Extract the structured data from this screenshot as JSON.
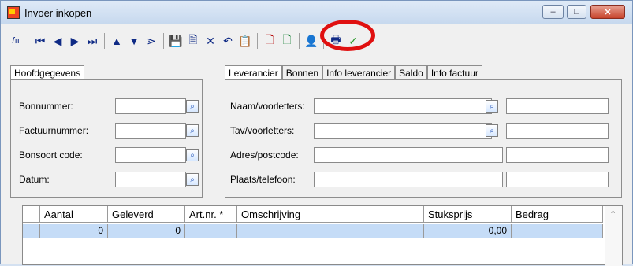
{
  "window": {
    "title": "Invoer inkopen",
    "controls": [
      "minimize",
      "maximize",
      "close"
    ]
  },
  "toolbar": {
    "icons": [
      "function-icon",
      "first-record-icon",
      "previous-record-icon",
      "next-record-icon",
      "last-record-icon",
      "sort-up-icon",
      "sort-down-icon",
      "filter-icon",
      "save-icon",
      "new-icon",
      "delete-icon",
      "undo-icon",
      "copy-icon",
      "export-pdf-icon",
      "export-excel-icon",
      "add-user-icon",
      "print-icon",
      "checkmark-icon"
    ]
  },
  "left_panel": {
    "tab": "Hoofdgegevens",
    "fields": [
      {
        "label": "Bonnummer:",
        "value": ""
      },
      {
        "label": "Factuurnummer:",
        "value": ""
      },
      {
        "label": "Bonsoort code:",
        "value": ""
      },
      {
        "label": "Datum:",
        "value": ""
      }
    ]
  },
  "right_panel": {
    "tabs": [
      "Leverancier",
      "Bonnen",
      "Info leverancier",
      "Saldo",
      "Info factuur"
    ],
    "fields": [
      {
        "label": "Naam/voorletters:",
        "value": "",
        "value2": ""
      },
      {
        "label": "Tav/voorletters:",
        "value": "",
        "value2": ""
      },
      {
        "label": "Adres/postcode:",
        "value": "",
        "value2": ""
      },
      {
        "label": "Plaats/telefoon:",
        "value": "",
        "value2": ""
      }
    ]
  },
  "grid": {
    "columns": [
      "Aantal",
      "Geleverd",
      "Art.nr. *",
      "Omschrijving",
      "Stuksprijs",
      "Bedrag"
    ],
    "rows": [
      {
        "aantal": "0",
        "geleverd": "0",
        "artnr": "",
        "omschrijving": "",
        "stuksprijs": "0,00",
        "bedrag": ""
      }
    ]
  }
}
